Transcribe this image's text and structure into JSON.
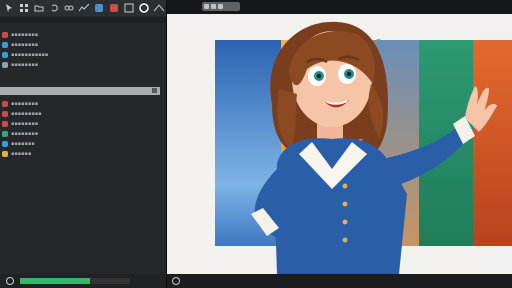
{
  "toolbar": {
    "icons": [
      "cursor-icon",
      "grid-icon",
      "folder-icon",
      "undo-icon",
      "link-icon",
      "wave-icon",
      "refresh-icon",
      "record-icon",
      "layout-icon",
      "settings-icon",
      "wave2-icon",
      "wave3-icon"
    ]
  },
  "sidebar": {
    "items_top": [
      {
        "label": "▪▪▪▪▪▪▪▪",
        "color": "#c94c4c"
      },
      {
        "label": "▪▪▪▪▪▪▪▪",
        "color": "#3b9ad8"
      },
      {
        "label": "▪▪▪▪▪▪▪▪▪▪▪",
        "color": "#3b9ad8"
      },
      {
        "label": "▪▪▪▪▪▪▪▪",
        "color": "#8fa0b0"
      }
    ],
    "items_bottom": [
      {
        "label": "▪▪▪▪▪▪▪▪",
        "color": "#c94c4c"
      },
      {
        "label": "▪▪▪▪▪▪▪▪▪",
        "color": "#c94c4c"
      },
      {
        "label": "▪▪▪▪▪▪▪▪",
        "color": "#c94c4c"
      },
      {
        "label": "▪▪▪▪▪▪▪▪",
        "color": "#34a87a"
      },
      {
        "label": "▪▪▪▪▪▪▪",
        "color": "#3b9ad8"
      },
      {
        "label": "▪▪▪▪▪▪",
        "color": "#e0b040"
      }
    ],
    "progress_fraction": 0.64
  },
  "colors": {
    "progress": "#35b86b",
    "panels": [
      "#2d6fb8",
      "#f2a93b",
      "#2a8f6a",
      "#d65a2a"
    ]
  }
}
